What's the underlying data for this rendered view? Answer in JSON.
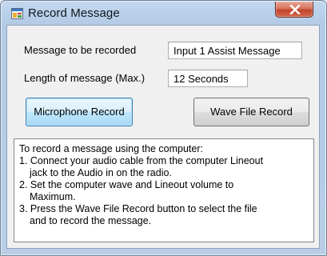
{
  "window": {
    "title": "Record Message",
    "close_label": "X"
  },
  "fields": {
    "message_label": "Message to be recorded",
    "message_value": "Input 1 Assist Message",
    "length_label": "Length of message (Max.)",
    "length_value": "12 Seconds"
  },
  "buttons": {
    "microphone_record": "Microphone Record",
    "wave_file_record": "Wave File Record"
  },
  "instructions": {
    "lines": [
      "To record a message using the computer:",
      "1. Connect your audio cable from the computer Lineout",
      "jack to the Audio in on the radio.",
      "2. Set the computer wave and Lineout volume to",
      "Maximum.",
      "3. Press the Wave File Record button to select the file",
      "and to record the message."
    ]
  },
  "icons": {
    "app": "window-app-icon",
    "close": "close-icon"
  },
  "colors": {
    "titlebar": "#b9cee6",
    "close_button": "#c1432b",
    "focused_button": "#bee6fd",
    "client_background": "#f0f0f0"
  }
}
